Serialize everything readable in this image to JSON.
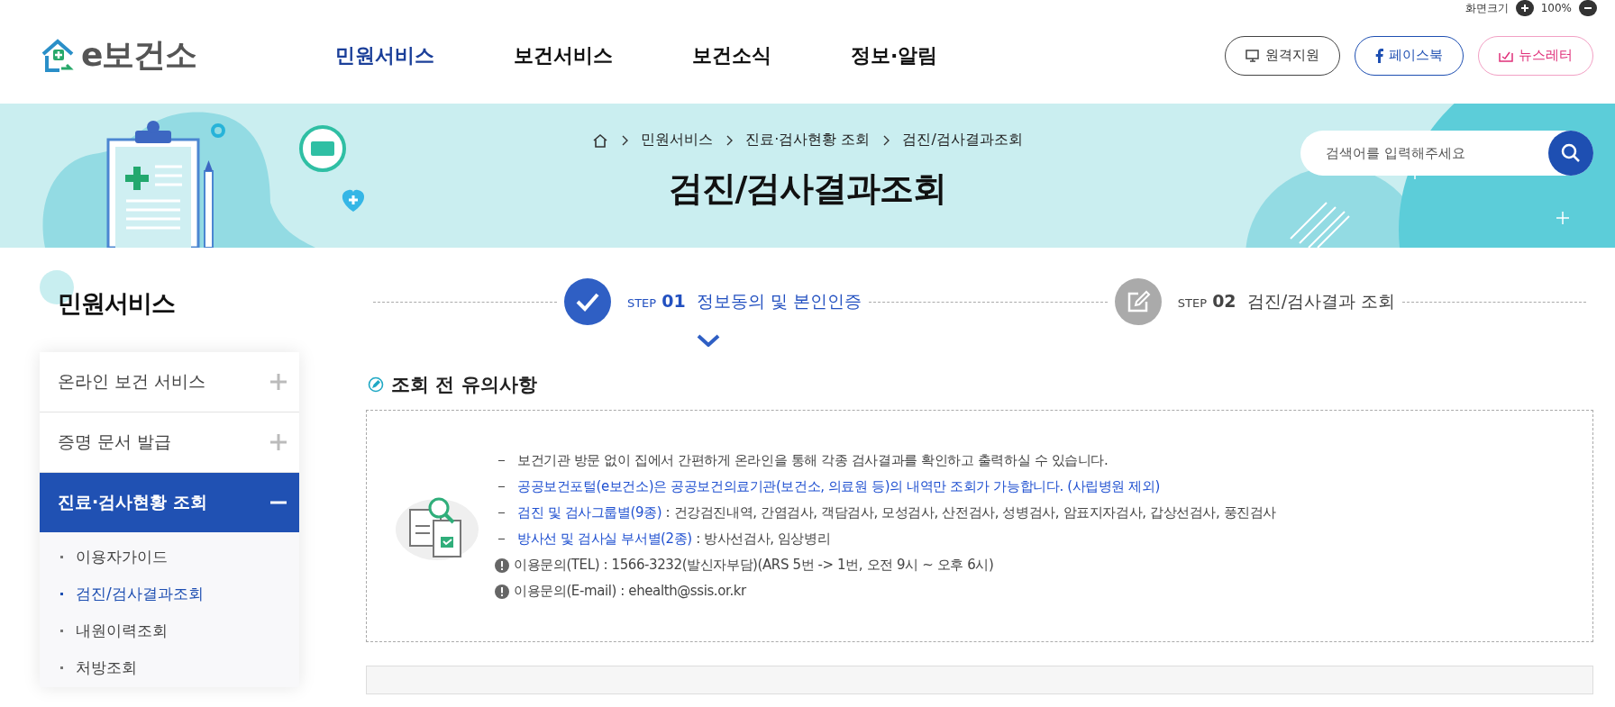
{
  "zoom_bar": {
    "label": "화면크기",
    "value": "100%"
  },
  "logo": {
    "text": "e보건소"
  },
  "nav": [
    {
      "label": "민원서비스",
      "selected": true
    },
    {
      "label": "보건서비스",
      "selected": false
    },
    {
      "label": "보건소식",
      "selected": false
    },
    {
      "label": "정보·알림",
      "selected": false
    }
  ],
  "header_buttons": [
    {
      "label": "원격지원",
      "kind": "remote"
    },
    {
      "label": "페이스북",
      "kind": "facebook"
    },
    {
      "label": "뉴스레터",
      "kind": "newsletter"
    }
  ],
  "breadcrumb": [
    "민원서비스",
    "진료·검사현황 조회",
    "검진/검사결과조회"
  ],
  "page_title": "검진/검사결과조회",
  "search": {
    "placeholder": "검색어를 입력해주세요"
  },
  "sidebar": {
    "title": "민원서비스",
    "items": [
      {
        "label": "온라인 보건 서비스",
        "expanded": false,
        "selected": false
      },
      {
        "label": "증명 문서 발급",
        "expanded": false,
        "selected": false
      },
      {
        "label": "진료·검사현황 조회",
        "expanded": true,
        "selected": true,
        "children": [
          {
            "label": "이용자가이드",
            "selected": false
          },
          {
            "label": "검진/검사결과조회",
            "selected": true
          },
          {
            "label": "내원이력조회",
            "selected": false
          },
          {
            "label": "처방조회",
            "selected": false
          }
        ]
      }
    ]
  },
  "steps": [
    {
      "step": "STEP",
      "number": "01",
      "label": "정보동의 및 본인인증",
      "selected": true,
      "kind": "check"
    },
    {
      "step": "STEP",
      "number": "02",
      "label": "검진/검사결과 조회",
      "selected": false,
      "kind": "edit"
    }
  ],
  "notice": {
    "title": "조회 전 유의사항",
    "lines": [
      {
        "kind": "dash",
        "text": "보건기관 방문 없이 집에서 간편하게 온라인을 통해 각종 검사결과를 확인하고 출력하실 수 있습니다."
      },
      {
        "kind": "dash",
        "lead": "공공보건포털(e보건소)은 공공보건의료기관(보건소, 의료원 등)의 내역만 조회가 가능합니다. (사립병원 제외)"
      },
      {
        "kind": "dash",
        "lead": "검진 및 검사그룹별(9종)",
        "text": ": 건강검진내역, 간염검사, 객담검사, 모성검사, 산전검사, 성병검사, 암표지자검사, 갑상선검사, 풍진검사"
      },
      {
        "kind": "dash",
        "lead": "방사선 및 검사실 부서별(2종)",
        "text": ": 방사선검사, 임상병리"
      },
      {
        "kind": "info",
        "text": "이용문의(TEL) : 1566-3232(발신자부담)(ARS 5번 -> 1번, 오전 9시 ~ 오후 6시)"
      },
      {
        "kind": "info",
        "text": "이용문의(E-mail) : ehealth@ssis.or.kr"
      }
    ]
  }
}
